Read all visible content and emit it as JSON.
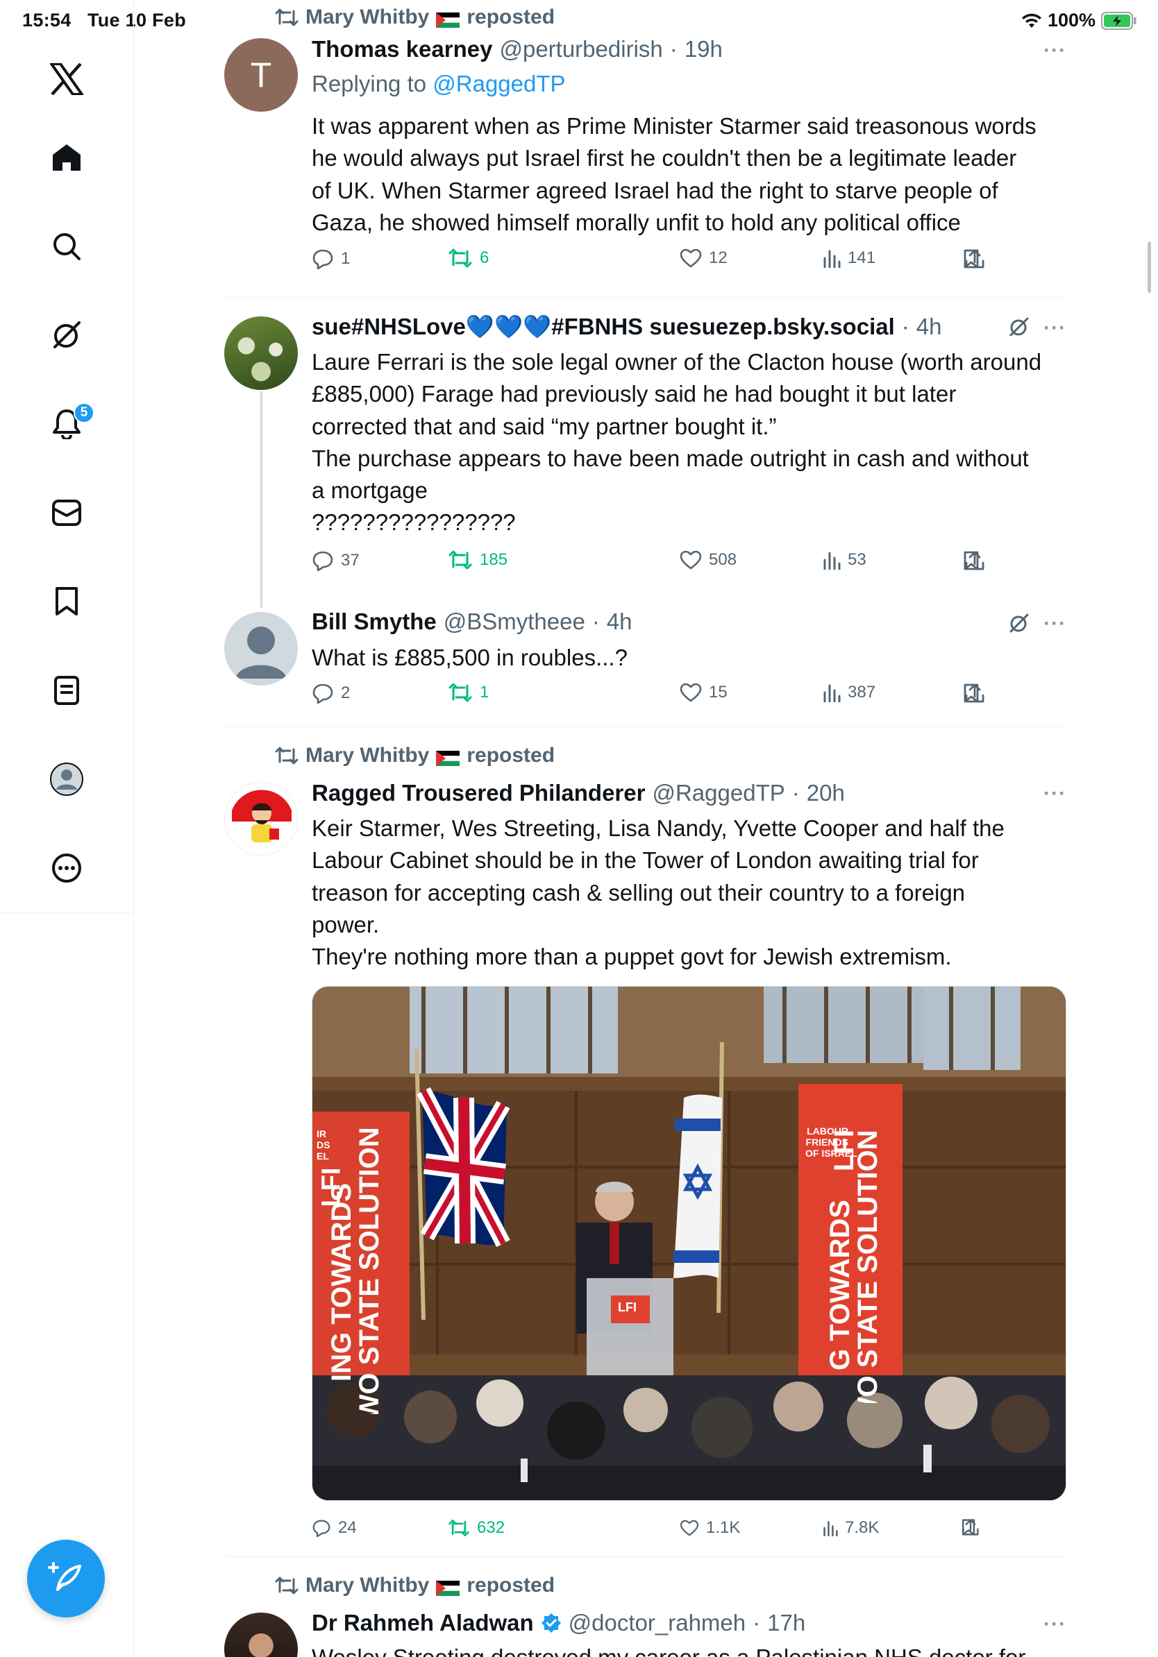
{
  "status_bar": {
    "time": "15:54",
    "date": "Tue 10 Feb",
    "battery": "100%"
  },
  "sidebar": {
    "items": [
      {
        "label": "X logo",
        "icon": "x-logo-icon"
      },
      {
        "label": "Home",
        "icon": "home-icon"
      },
      {
        "label": "Explore",
        "icon": "search-icon"
      },
      {
        "label": "Grok",
        "icon": "grok-icon"
      },
      {
        "label": "Notifications",
        "icon": "bell-icon",
        "badge": "5"
      },
      {
        "label": "Messages",
        "icon": "mail-icon"
      },
      {
        "label": "Bookmarks",
        "icon": "bookmark-icon"
      },
      {
        "label": "Lists",
        "icon": "lists-icon"
      },
      {
        "label": "Profile",
        "icon": "profile-icon"
      },
      {
        "label": "More",
        "icon": "more-icon"
      }
    ],
    "compose_icon": "compose-icon"
  },
  "tweets": [
    {
      "repost_by": "Mary Whitby",
      "repost_suffix": "reposted",
      "avatar_letter": "T",
      "avatar_color": "#8b6a5c",
      "name": "Thomas kearney",
      "handle": "@perturbedirish",
      "dot": "·",
      "time": "19h",
      "more": "···",
      "reply_prefix": "Replying to ",
      "reply_handle": "@RaggedTP",
      "text": "It was apparent when as Prime Minister  Starmer said treasonous words\nhe would always put Israel first he couldn't then be a legitimate leader\nof UK. When Starmer agreed Israel had the right to starve people of\nGaza, he showed himself morally unfit to hold any political office",
      "replies": "1",
      "reposts": "6",
      "likes": "12",
      "views": "141"
    },
    {
      "name": "sue#NHSLove💙💙💙#FBNHS suesuezep.bsky.social",
      "dot": "·",
      "time": "4h",
      "more": "···",
      "text": "Laure Ferrari is the sole legal owner of the Clacton house (worth around\n£885,000) Farage had previously said he had bought it but later\ncorrected that and said “my partner bought it.”\nThe purchase appears to have been made outright in cash and without\na mortgage\n????????????????",
      "replies": "37",
      "reposts": "185",
      "likes": "508",
      "views": "53"
    },
    {
      "name": "Bill Smythe",
      "handle": "@BSmytheee",
      "dot": "·",
      "time": "4h",
      "more": "···",
      "text": "What is £885,500 in roubles...?",
      "replies": "2",
      "reposts": "1",
      "likes": "15",
      "views": "387"
    },
    {
      "repost_by": "Mary Whitby",
      "repost_suffix": "reposted",
      "name": "Ragged Trousered Philanderer",
      "handle": "@RaggedTP",
      "dot": "·",
      "time": "20h",
      "more": "···",
      "text": "Keir Starmer, Wes Streeting, Lisa Nandy, Yvette Cooper and half the\nLabour Cabinet should be in the Tower of London awaiting trial for\ntreason for accepting cash & selling out their country to a foreign\npower.\nThey're nothing more than a puppet govt for Jewish extremism.",
      "media": {
        "banner_left_small": "IR\nDS\nEL",
        "banner_left_lfi": "LFI",
        "banner_left_main": "ING TOWARDS\nTWO STATE SOLUTION",
        "banner_right_small": "LABOUR\nFRIENDS\nOF ISRAEL",
        "banner_right_lfi": "LFI",
        "banner_right_main": "G TOWARDS\nTWO STATE SOLUTION",
        "podium_label": "LFI"
      },
      "replies": "24",
      "reposts": "632",
      "likes": "1.1K",
      "views": "7.8K"
    },
    {
      "repost_by": "Mary Whitby",
      "repost_suffix": "reposted",
      "name": "Dr Rahmeh Aladwan",
      "handle": "@doctor_rahmeh",
      "dot": "·",
      "time": "17h",
      "more": "···",
      "text": "Wesley Streeting destroyed my career as a Palestinian NHS doctor for"
    }
  ]
}
